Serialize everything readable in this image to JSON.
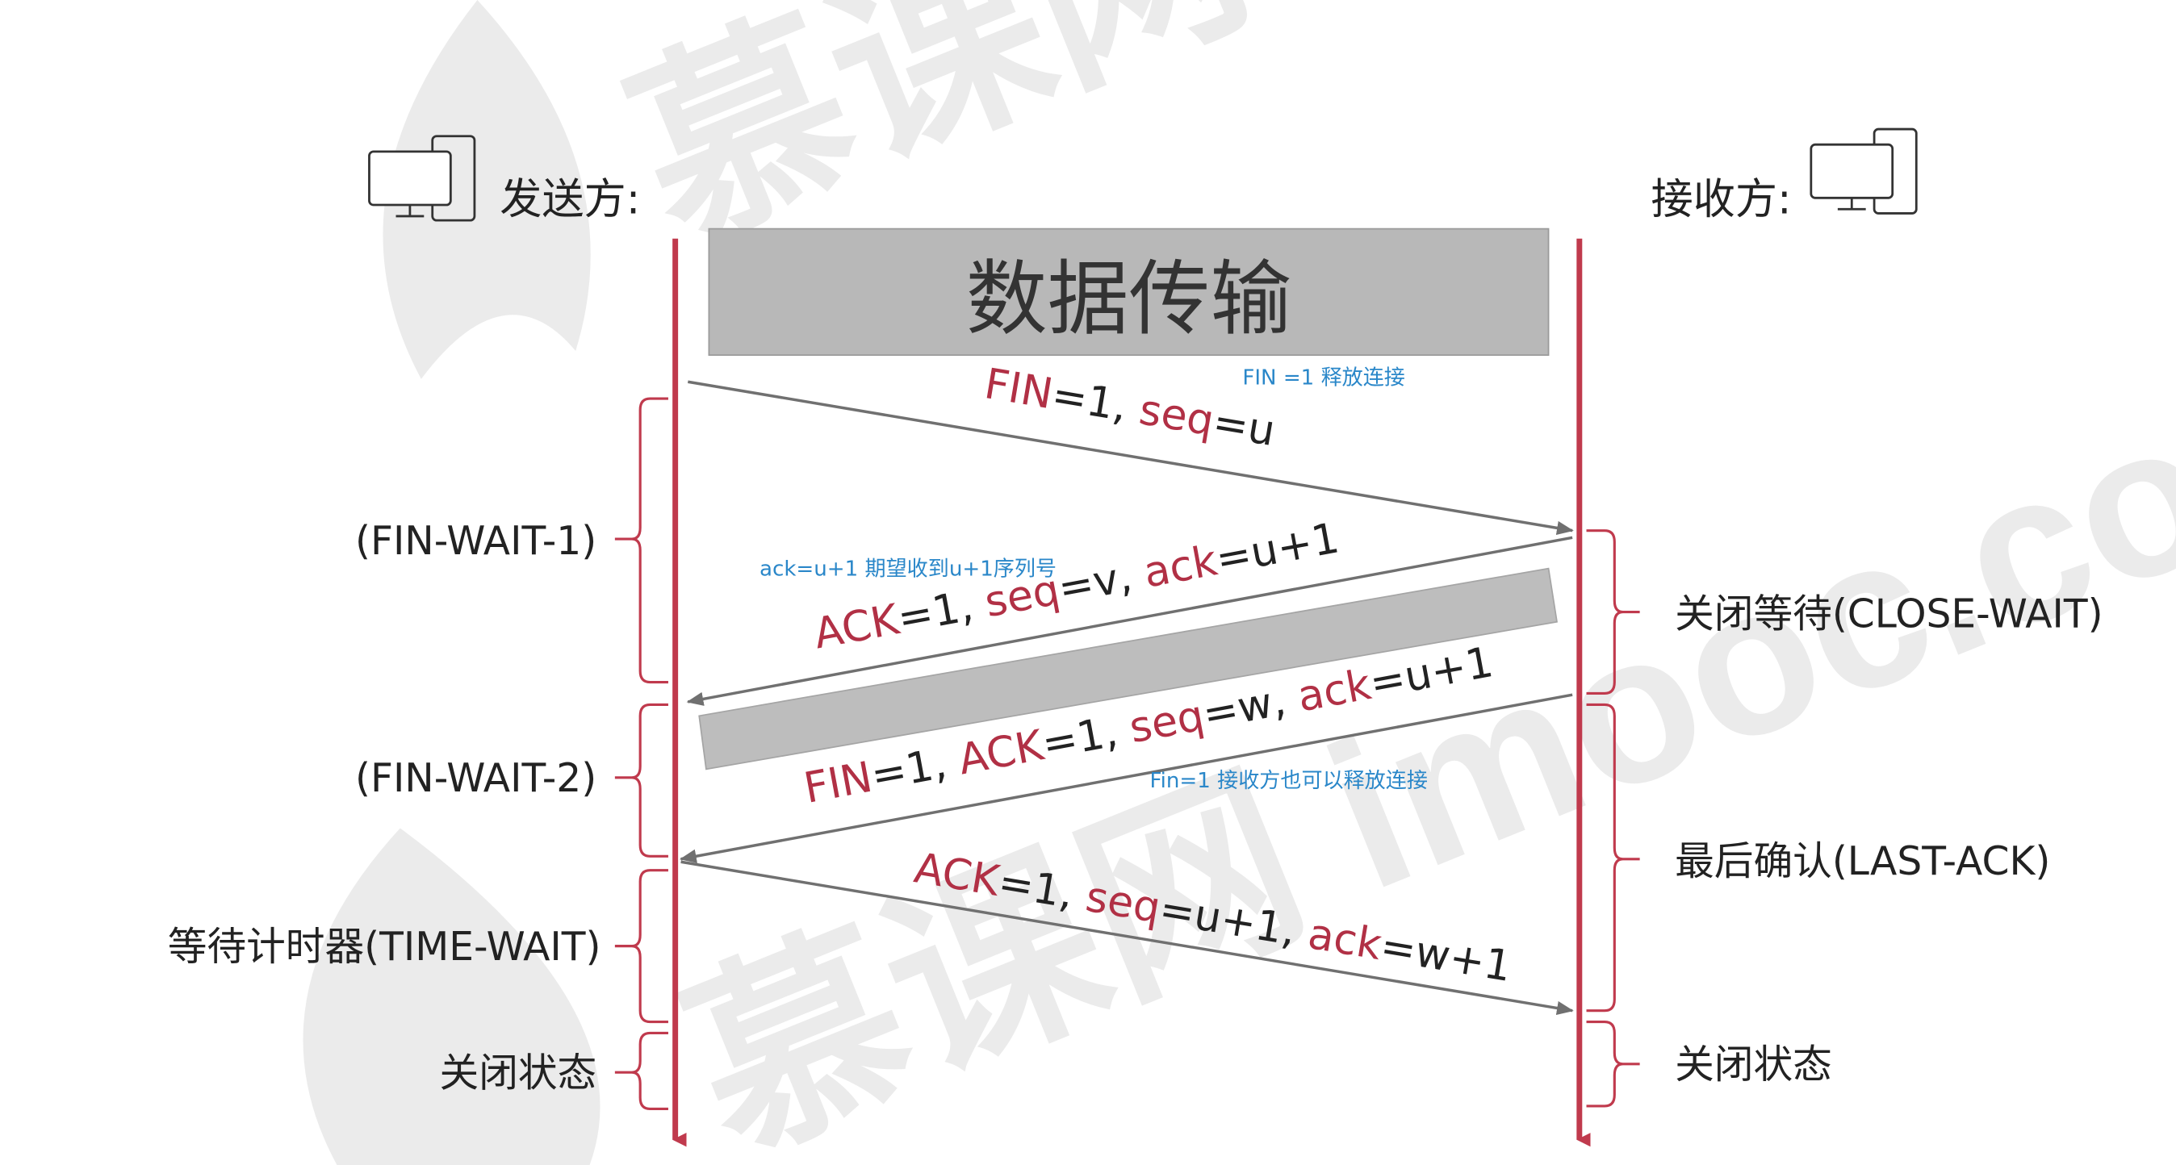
{
  "diagram": {
    "sender": {
      "label": "发送方:",
      "icon": "computer-icon"
    },
    "receiver": {
      "label": "接收方:",
      "icon": "computer-icon"
    },
    "data_transfer_box": "数据传输",
    "watermark": "慕课网 imooc.com",
    "colors": {
      "lifeline": "#c03a4d",
      "keyword": "#b13045",
      "annotation": "#2a87c9",
      "box": "#b8b8b8",
      "arrow": "#707070"
    },
    "messages": [
      {
        "id": "fin1",
        "parts": [
          {
            "text": "FIN",
            "color": "red"
          },
          {
            "text": "=1, ",
            "color": "dark"
          },
          {
            "text": "seq",
            "color": "red"
          },
          {
            "text": "=u",
            "color": "dark"
          }
        ]
      },
      {
        "id": "ack1",
        "parts": [
          {
            "text": "ACK",
            "color": "red"
          },
          {
            "text": "=1, ",
            "color": "dark"
          },
          {
            "text": "seq",
            "color": "red"
          },
          {
            "text": "=v, ",
            "color": "dark"
          },
          {
            "text": "ack",
            "color": "red"
          },
          {
            "text": "=u+1",
            "color": "dark"
          }
        ]
      },
      {
        "id": "fin2",
        "parts": [
          {
            "text": "FIN",
            "color": "red"
          },
          {
            "text": "=1, ",
            "color": "dark"
          },
          {
            "text": "ACK",
            "color": "red"
          },
          {
            "text": "=1, ",
            "color": "dark"
          },
          {
            "text": "seq",
            "color": "red"
          },
          {
            "text": "=w, ",
            "color": "dark"
          },
          {
            "text": "ack",
            "color": "red"
          },
          {
            "text": "=u+1",
            "color": "dark"
          }
        ]
      },
      {
        "id": "ack2",
        "parts": [
          {
            "text": "ACK",
            "color": "red"
          },
          {
            "text": "=1, ",
            "color": "dark"
          },
          {
            "text": "seq",
            "color": "red"
          },
          {
            "text": "=u+1, ",
            "color": "dark"
          },
          {
            "text": "ack",
            "color": "red"
          },
          {
            "text": "=w+1",
            "color": "dark"
          }
        ]
      }
    ],
    "annotations": {
      "fin1_note": "FIN =1 释放连接",
      "ack1_note": "ack=u+1 期望收到u+1序列号",
      "fin2_note": "Fin=1 接收方也可以释放连接"
    },
    "sender_states": [
      "(FIN-WAIT-1)",
      "(FIN-WAIT-2)",
      "等待计时器(TIME-WAIT)",
      "关闭状态"
    ],
    "receiver_states": [
      "关闭等待(CLOSE-WAIT)",
      "最后确认(LAST-ACK)",
      "关闭状态"
    ]
  }
}
